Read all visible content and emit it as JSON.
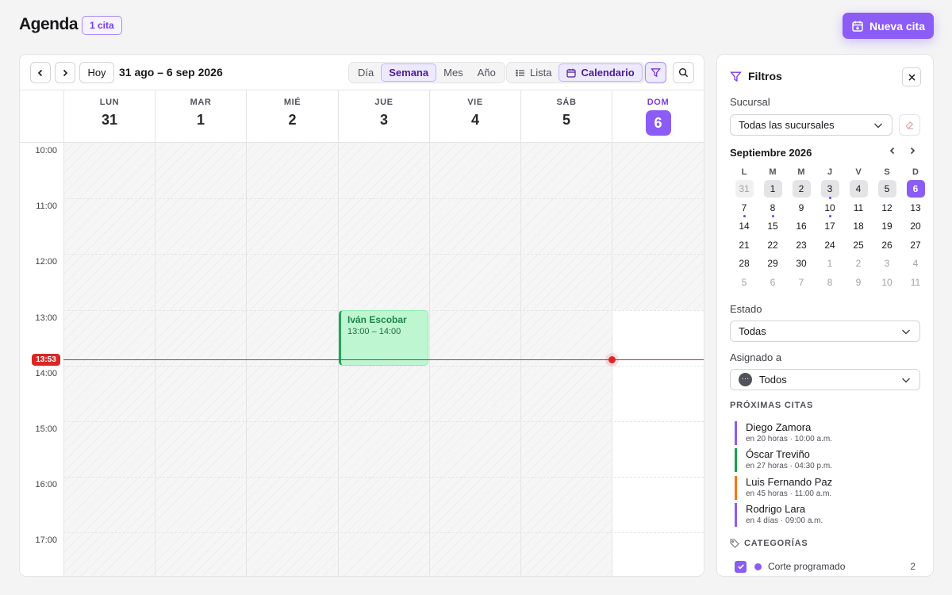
{
  "header": {
    "title": "Agenda",
    "count_badge": "1 cita",
    "new_button": "Nueva cita"
  },
  "toolbar": {
    "today_label": "Hoy",
    "range_label": "31 ago – 6 sep 2026",
    "views": [
      {
        "label": "Día",
        "active": false
      },
      {
        "label": "Semana",
        "active": true
      },
      {
        "label": "Mes",
        "active": false
      },
      {
        "label": "Año",
        "active": false
      }
    ],
    "modes": [
      {
        "label": "Lista",
        "active": false
      },
      {
        "label": "Calendario",
        "active": true
      }
    ]
  },
  "week": {
    "days": [
      {
        "name": "LUN",
        "date": "31"
      },
      {
        "name": "MAR",
        "date": "1"
      },
      {
        "name": "MIÉ",
        "date": "2"
      },
      {
        "name": "JUE",
        "date": "3"
      },
      {
        "name": "VIE",
        "date": "4"
      },
      {
        "name": "SÁB",
        "date": "5"
      },
      {
        "name": "DOM",
        "date": "6",
        "today": true
      }
    ],
    "hours": [
      "10:00",
      "11:00",
      "12:00",
      "13:00",
      "14:00",
      "15:00",
      "16:00",
      "17:00"
    ],
    "now_label": "13:53",
    "event": {
      "name": "Iván Escobar",
      "time": "13:00 – 14:00"
    }
  },
  "filters": {
    "title": "Filtros",
    "branch_label": "Sucursal",
    "branch_value": "Todas las sucursales",
    "mini_calendar": {
      "title": "Septiembre 2026",
      "weekdays": [
        "L",
        "M",
        "M",
        "J",
        "V",
        "S",
        "D"
      ],
      "weeks": [
        [
          "31",
          "1",
          "2",
          "3",
          "4",
          "5",
          "6"
        ],
        [
          "7",
          "8",
          "9",
          "10",
          "11",
          "12",
          "13"
        ],
        [
          "14",
          "15",
          "16",
          "17",
          "18",
          "19",
          "20"
        ],
        [
          "21",
          "22",
          "23",
          "24",
          "25",
          "26",
          "27"
        ],
        [
          "28",
          "29",
          "30",
          "1",
          "2",
          "3",
          "4"
        ],
        [
          "5",
          "6",
          "7",
          "8",
          "9",
          "10",
          "11"
        ]
      ]
    },
    "status_label": "Estado",
    "status_value": "Todas",
    "assigned_label": "Asignado a",
    "assigned_value": "Todos",
    "upcoming_title": "PRÓXIMAS CITAS",
    "upcoming": [
      {
        "name": "Diego Zamora",
        "meta": "en 20 horas · 10:00 a.m.",
        "color": "#8b5cf6"
      },
      {
        "name": "Óscar Treviño",
        "meta": "en 27 horas · 04:30 p.m.",
        "color": "#16a34a"
      },
      {
        "name": "Luis Fernando Paz",
        "meta": "en 45 horas · 11:00 a.m.",
        "color": "#f97316"
      },
      {
        "name": "Rodrigo Lara",
        "meta": "en 4 días · 09:00 a.m.",
        "color": "#8b5cf6"
      }
    ],
    "categories_title": "CATEGORÍAS",
    "categories": [
      {
        "label": "Corte programado",
        "count": "2",
        "color": "#8b5cf6"
      }
    ]
  },
  "colors": {
    "accent": "#8b5cf6",
    "now": "#dc2626",
    "event": "#16a34a"
  }
}
